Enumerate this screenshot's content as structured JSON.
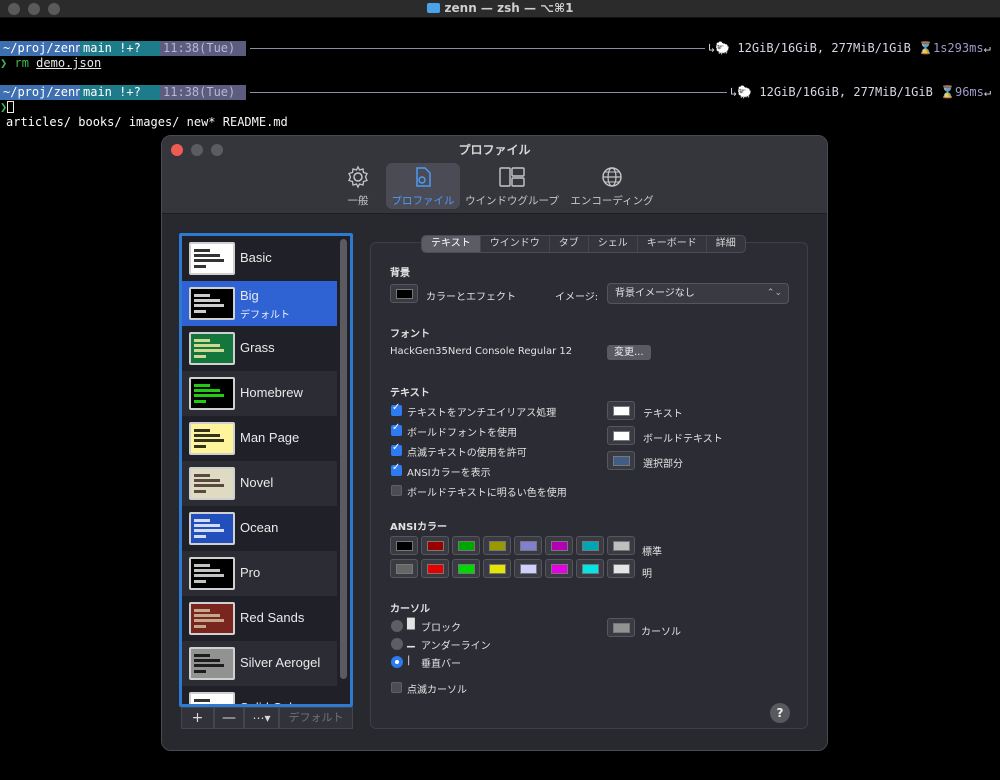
{
  "terminal": {
    "title": "zenn — zsh — ⌥⌘1",
    "line1": {
      "path": "~/proj/zenn",
      "git": " main !+?",
      "time": "11:38(Tue)",
      "status": "12GiB/16GiB, 277MiB/1GiB",
      "duration": "1s293ms"
    },
    "cmd1": {
      "command": "rm",
      "arg": "demo.json"
    },
    "line2": {
      "path": "~/proj/zenn",
      "git": " main !+?",
      "time": "11:38(Tue)",
      "status": "12GiB/16GiB, 277MiB/1GiB",
      "duration": "96ms"
    },
    "ls_output": "articles/ books/ images/ new* README.md"
  },
  "prefs": {
    "title": "プロファイル",
    "toolbar": [
      {
        "label": "一般",
        "icon": "gear-icon"
      },
      {
        "label": "プロファイル",
        "icon": "profile-doc-icon"
      },
      {
        "label": "ウインドウグループ",
        "icon": "window-group-icon"
      },
      {
        "label": "エンコーディング",
        "icon": "globe-icon"
      }
    ],
    "profiles": [
      {
        "name": "Basic",
        "bg": "#ffffff",
        "fg": "#000000"
      },
      {
        "name": "Big",
        "sub": "デフォルト",
        "bg": "#000000",
        "fg": "#ffffff"
      },
      {
        "name": "Grass",
        "bg": "#13773d",
        "fg": "#fff0a5"
      },
      {
        "name": "Homebrew",
        "bg": "#000000",
        "fg": "#28fe14"
      },
      {
        "name": "Man Page",
        "bg": "#fef49c",
        "fg": "#000000"
      },
      {
        "name": "Novel",
        "bg": "#dfdbc3",
        "fg": "#3b2322"
      },
      {
        "name": "Ocean",
        "bg": "#224fbc",
        "fg": "#ffffff"
      },
      {
        "name": "Pro",
        "bg": "#000000",
        "fg": "#f2f2f2"
      },
      {
        "name": "Red Sands",
        "bg": "#7a251e",
        "fg": "#d7c9a7"
      },
      {
        "name": "Silver Aerogel",
        "bg": "#929292",
        "fg": "#000000"
      },
      {
        "name": "Solid Colors",
        "bg": "#ffffff",
        "fg": "#000000"
      }
    ],
    "list_buttons": {
      "add": "+",
      "remove": "—",
      "more": "⋯▾",
      "default": "デフォルト"
    },
    "tabs": [
      "テキスト",
      "ウインドウ",
      "タブ",
      "シェル",
      "キーボード",
      "詳細"
    ],
    "background": {
      "section": "背景",
      "color_label": "カラーとエフェクト",
      "color": "#000000",
      "image_label": "イメージ:",
      "image_value": "背景イメージなし"
    },
    "font": {
      "section": "フォント",
      "name": "HackGen35Nerd Console Regular 12",
      "change_button": "変更..."
    },
    "text": {
      "section": "テキスト",
      "options": [
        {
          "label": "テキストをアンチエイリアス処理",
          "checked": true
        },
        {
          "label": "ボールドフォントを使用",
          "checked": true
        },
        {
          "label": "点滅テキストの使用を許可",
          "checked": true
        },
        {
          "label": "ANSIカラーを表示",
          "checked": true
        },
        {
          "label": "ボールドテキストに明るい色を使用",
          "checked": false
        }
      ],
      "colors": [
        {
          "label": "テキスト",
          "color": "#ffffff"
        },
        {
          "label": "ボールドテキスト",
          "color": "#ffffff"
        },
        {
          "label": "選択部分",
          "color": "#3f5d85"
        }
      ]
    },
    "ansi": {
      "section": "ANSIカラー",
      "normal_label": "標準",
      "bright_label": "明",
      "normal": [
        "#000000",
        "#990000",
        "#00a600",
        "#999900",
        "#8080d0",
        "#b200b2",
        "#00a6b2",
        "#bfbfbf"
      ],
      "bright": [
        "#666666",
        "#e50000",
        "#00d900",
        "#e5e500",
        "#d0d0ff",
        "#e500e5",
        "#00e5e5",
        "#e5e5e5"
      ]
    },
    "cursor": {
      "section": "カーソル",
      "options": [
        {
          "glyph": "█",
          "label": "ブロック",
          "selected": false
        },
        {
          "glyph": "▁",
          "label": "アンダーライン",
          "selected": false
        },
        {
          "glyph": "|",
          "label": "垂直バー",
          "selected": true
        }
      ],
      "blink_label": "点滅カーソル",
      "blink": false,
      "color_label": "カーソル",
      "color": "#929292"
    },
    "help": "?"
  }
}
